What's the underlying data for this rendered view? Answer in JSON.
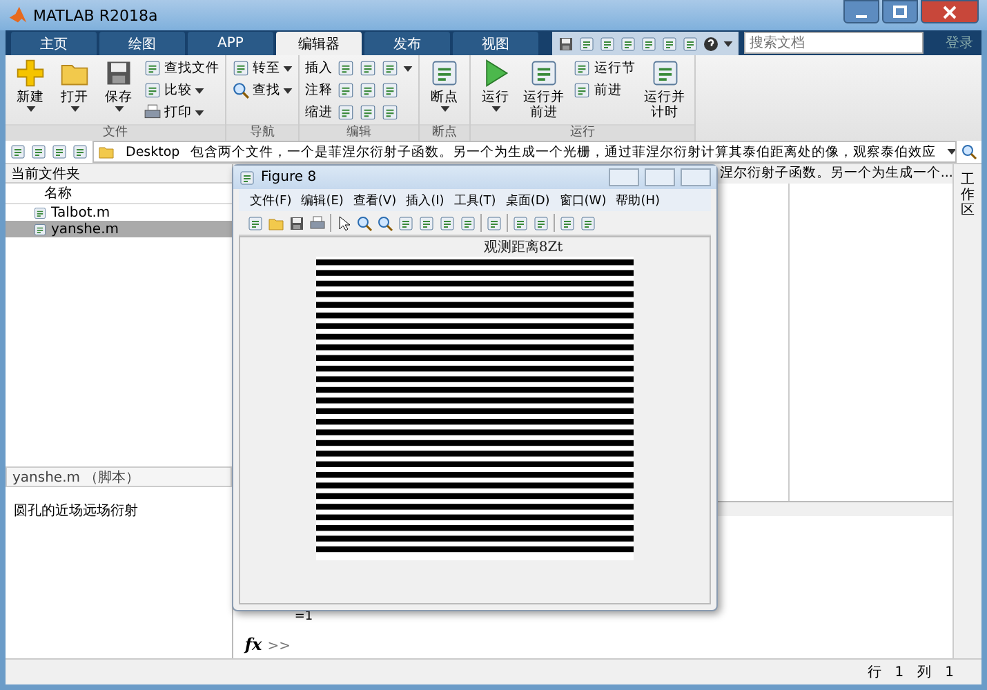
{
  "window": {
    "title": "MATLAB R2018a"
  },
  "tabs": [
    {
      "label": "主页",
      "selected": false
    },
    {
      "label": "绘图",
      "selected": false
    },
    {
      "label": "APP",
      "selected": false
    },
    {
      "label": "编辑器",
      "selected": true
    },
    {
      "label": "发布",
      "selected": false
    },
    {
      "label": "视图",
      "selected": false
    }
  ],
  "search": {
    "placeholder": "搜索文档"
  },
  "login": "登录",
  "ribbon": {
    "groups": [
      {
        "label": "文件",
        "items": [
          {
            "label": "新建",
            "kind": "large",
            "dropdown": true
          },
          {
            "label": "打开",
            "kind": "large",
            "dropdown": true
          },
          {
            "label": "保存",
            "kind": "large",
            "dropdown": true
          },
          {
            "label": "查找文件",
            "kind": "small",
            "dropdown": false
          },
          {
            "label": "比较",
            "kind": "small",
            "dropdown": true
          },
          {
            "label": "打印",
            "kind": "small",
            "dropdown": true
          }
        ]
      },
      {
        "label": "导航",
        "items": [
          {
            "label": "转至",
            "kind": "small",
            "dropdown": true
          },
          {
            "label": "查找",
            "kind": "small",
            "dropdown": true
          }
        ]
      },
      {
        "label": "编辑",
        "items": [
          {
            "label": "插入",
            "kind": "row",
            "dropdown": true
          },
          {
            "label": "注释",
            "kind": "row",
            "dropdown": false
          },
          {
            "label": "缩进",
            "kind": "row",
            "dropdown": false
          }
        ]
      },
      {
        "label": "断点",
        "items": [
          {
            "label": "断点",
            "kind": "large",
            "dropdown": true
          }
        ]
      },
      {
        "label": "运行",
        "items": [
          {
            "label": "运行",
            "kind": "large",
            "dropdown": true
          },
          {
            "label": "运行并前进",
            "kind": "large",
            "dropdown": false
          },
          {
            "label": "运行节",
            "kind": "small",
            "dropdown": false
          },
          {
            "label": "前进",
            "kind": "small",
            "dropdown": false
          },
          {
            "label": "运行并计时",
            "kind": "large",
            "dropdown": false
          }
        ]
      }
    ]
  },
  "address": {
    "crumbs": [
      "Desktop",
      "包含两个文件，一个是菲涅尔衍射子函数。另一个为生成一个光栅，通过菲涅尔衍射计算其泰伯距离处的像，观察泰伯效应"
    ]
  },
  "current_folder": {
    "title": "当前文件夹",
    "column": "名称",
    "files": [
      {
        "name": "Talbot.m",
        "selected": false
      },
      {
        "name": "yanshe.m",
        "selected": true
      }
    ]
  },
  "details": {
    "title": "yanshe.m （脚本）",
    "description": "圆孔的近场远场衍射"
  },
  "editor": {
    "header": "涅尔衍射子函数。另一个为生成一个..."
  },
  "command_window": {
    "output": "=1",
    "fx_label": "fx",
    "prompt": ">>"
  },
  "side_tab": "工作区",
  "status_bar": {
    "row_label": "行",
    "row": "1",
    "col_label": "列",
    "col": "1"
  },
  "figure": {
    "title": "Figure 8",
    "menu": [
      "文件(F)",
      "编辑(E)",
      "查看(V)",
      "插入(I)",
      "工具(T)",
      "桌面(D)",
      "窗口(W)",
      "帮助(H)"
    ],
    "plot_title": "观测距离8Zt"
  }
}
